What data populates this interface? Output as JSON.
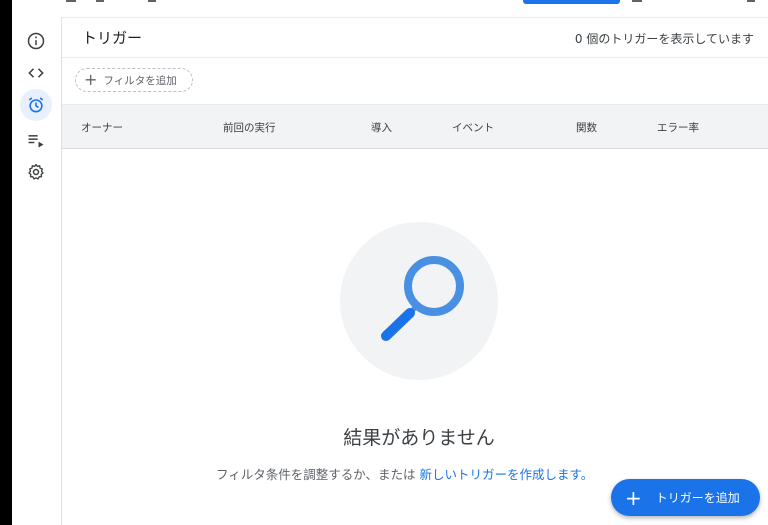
{
  "sidebar": {
    "items": [
      {
        "name": "overview",
        "icon": "info-icon"
      },
      {
        "name": "editor",
        "icon": "code-icon"
      },
      {
        "name": "triggers",
        "icon": "alarm-clock-icon",
        "active": true
      },
      {
        "name": "executions",
        "icon": "playlist-play-icon"
      },
      {
        "name": "settings",
        "icon": "gear-icon"
      }
    ]
  },
  "header": {
    "title": "トリガー",
    "count_text": "0 個のトリガーを表示しています"
  },
  "filter": {
    "add_label": "フィルタを追加"
  },
  "table": {
    "columns": [
      "オーナー",
      "前回の実行",
      "導入",
      "イベント",
      "関数",
      "エラー率"
    ]
  },
  "empty_state": {
    "title": "結果がありません",
    "subtitle_prefix": "フィルタ条件を調整するか、または ",
    "subtitle_link": "新しいトリガーを作成します。"
  },
  "fab": {
    "label": "トリガーを追加"
  },
  "colors": {
    "accent": "#1a73e8",
    "active_bg": "#e8f0fe",
    "header_bg": "#f1f3f4"
  }
}
